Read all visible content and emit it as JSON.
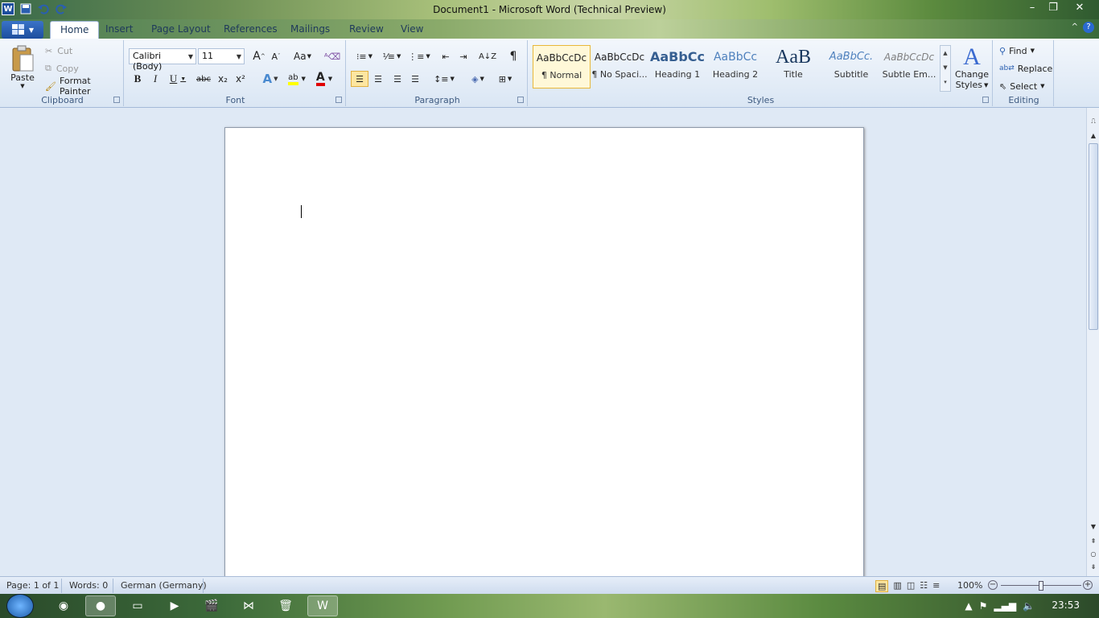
{
  "window": {
    "title": "Document1  -  Microsoft Word (Technical Preview)",
    "min_icon": "minimize-icon",
    "restore_icon": "restore-icon",
    "close_icon": "close-icon"
  },
  "qat": {
    "word_icon": "W",
    "save_icon": "save-icon",
    "undo_icon": "undo-icon",
    "redo_icon": "redo-icon"
  },
  "tabs": [
    "Home",
    "Insert",
    "Page Layout",
    "References",
    "Mailings",
    "Review",
    "View"
  ],
  "clipboard": {
    "paste": "Paste",
    "cut": "Cut",
    "copy": "Copy",
    "format_painter": "Format Painter",
    "label": "Clipboard"
  },
  "font": {
    "family": "Calibri (Body)",
    "size": "11",
    "label": "Font",
    "grow": "A",
    "shrink": "A",
    "change_case": "Aa",
    "bold": "B",
    "italic": "I",
    "underline": "U",
    "strike": "abc",
    "sub": "x₂",
    "sup": "x²",
    "text_effects": "A",
    "highlight": "ab",
    "font_color": "A"
  },
  "paragraph": {
    "label": "Paragraph",
    "pilcrow": "¶"
  },
  "styles": {
    "label": "Styles",
    "items": [
      {
        "sample": "AaBbCcDc",
        "name": "¶ Normal"
      },
      {
        "sample": "AaBbCcDc",
        "name": "¶ No Spaci..."
      },
      {
        "sample": "AaBbCc",
        "name": "Heading 1"
      },
      {
        "sample": "AaBbCc",
        "name": "Heading 2"
      },
      {
        "sample": "AaB",
        "name": "Title"
      },
      {
        "sample": "AaBbCc.",
        "name": "Subtitle"
      },
      {
        "sample": "AaBbCcDc",
        "name": "Subtle Em..."
      }
    ],
    "change_styles_line1": "Change",
    "change_styles_line2": "Styles"
  },
  "editing": {
    "label": "Editing",
    "find": "Find",
    "replace": "Replace",
    "select": "Select"
  },
  "status": {
    "page": "Page: 1 of 1",
    "words": "Words: 0",
    "language": "German (Germany)",
    "zoom": "100%",
    "zoom_level": 1.0
  },
  "taskbar": {
    "clock": "23:53"
  },
  "colors": {
    "accent": "#1e395b",
    "ribbon_top": "#f3f7fc",
    "ribbon_bottom": "#dae6f4",
    "selected_style": "#fff8d8",
    "heading_blue": "#365f91"
  }
}
